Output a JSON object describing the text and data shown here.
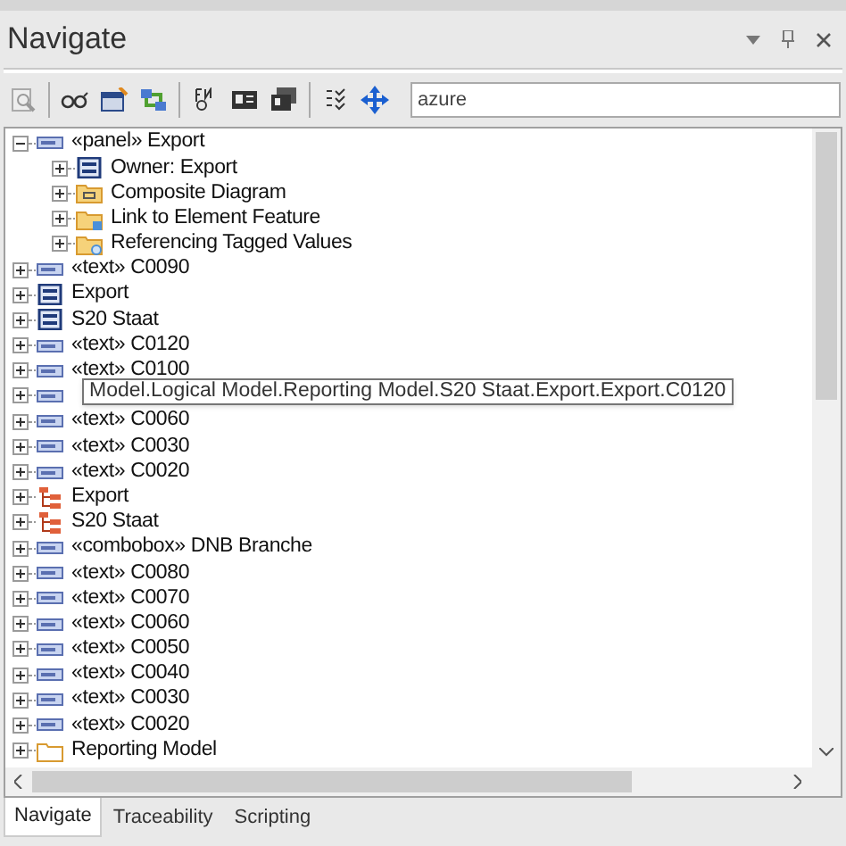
{
  "window": {
    "title": "Navigate"
  },
  "toolbar": {
    "search": {
      "value": "azure"
    }
  },
  "tree": [
    {
      "kind": "element",
      "label": "«panel» Export",
      "expanded": true,
      "children": [
        {
          "kind": "diagram",
          "label": "Owner: Export"
        },
        {
          "kind": "folder-diagram",
          "label": "Composite Diagram"
        },
        {
          "kind": "folder-link",
          "label": "Link to Element Feature"
        },
        {
          "kind": "folder-search",
          "label": "Referencing Tagged Values"
        }
      ]
    },
    {
      "kind": "element",
      "label": "«text» C0090",
      "expanded": false
    },
    {
      "kind": "diagram",
      "label": "Export",
      "expanded": false
    },
    {
      "kind": "diagram",
      "label": "S20 Staat",
      "expanded": false
    },
    {
      "kind": "element",
      "label": "«text» C0120",
      "expanded": false
    },
    {
      "kind": "element",
      "label": "«text» C0100",
      "expanded": false
    },
    {
      "kind": "element",
      "expanded": false
    },
    {
      "kind": "element",
      "label": "«text» C0060",
      "expanded": false
    },
    {
      "kind": "element",
      "label": "«text» C0030",
      "expanded": false
    },
    {
      "kind": "element",
      "label": "«text» C0020",
      "expanded": false
    },
    {
      "kind": "package",
      "label": "Export",
      "expanded": false
    },
    {
      "kind": "package",
      "label": "S20 Staat",
      "expanded": false
    },
    {
      "kind": "element",
      "label": "«combobox» DNB Branche",
      "expanded": false
    },
    {
      "kind": "element",
      "label": "«text» C0080",
      "expanded": false
    },
    {
      "kind": "element",
      "label": "«text» C0070",
      "expanded": false
    },
    {
      "kind": "element",
      "label": "«text» C0060",
      "expanded": false
    },
    {
      "kind": "element",
      "label": "«text» C0050",
      "expanded": false
    },
    {
      "kind": "element",
      "label": "«text» C0040",
      "expanded": false
    },
    {
      "kind": "element",
      "label": "«text» C0030",
      "expanded": false
    },
    {
      "kind": "element",
      "label": "«text» C0020",
      "expanded": false
    },
    {
      "kind": "folder",
      "label": "Reporting Model",
      "expanded": false
    }
  ],
  "tooltip": "Model.Logical Model.Reporting Model.S20 Staat.Export.Export.C0120",
  "tabs": [
    {
      "label": "Navigate",
      "selected": true
    },
    {
      "label": "Traceability",
      "selected": false
    },
    {
      "label": "Scripting",
      "selected": false
    }
  ]
}
